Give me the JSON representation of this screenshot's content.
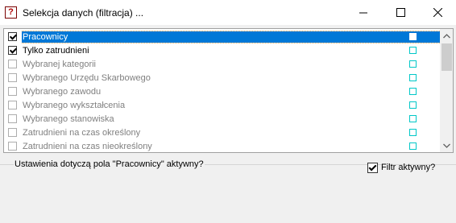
{
  "window": {
    "title": "Selekcja danych (filtracja) ...",
    "app_icon": "app-icon",
    "app_icon_glyph": "?"
  },
  "list": {
    "items": [
      {
        "label": "Pracownicy",
        "checked": true,
        "enabled": true,
        "selected": true
      },
      {
        "label": "Tylko zatrudnieni",
        "checked": true,
        "enabled": true,
        "selected": false
      },
      {
        "label": "Wybranej kategorii",
        "checked": false,
        "enabled": false,
        "selected": false
      },
      {
        "label": "Wybranego Urzędu Skarbowego",
        "checked": false,
        "enabled": false,
        "selected": false
      },
      {
        "label": "Wybranego zawodu",
        "checked": false,
        "enabled": false,
        "selected": false
      },
      {
        "label": "Wybranego wykształcenia",
        "checked": false,
        "enabled": false,
        "selected": false
      },
      {
        "label": "Wybranego stanowiska",
        "checked": false,
        "enabled": false,
        "selected": false
      },
      {
        "label": "Zatrudnieni na czas określony",
        "checked": false,
        "enabled": false,
        "selected": false
      },
      {
        "label": "Zatrudnieni na czas nieokreślony",
        "checked": false,
        "enabled": false,
        "selected": false
      }
    ],
    "marker_color": "#00c8c8",
    "selection_color": "#0078d7"
  },
  "settings": {
    "group_label": "Ustawienia dotyczą pola \"Pracownicy\" aktywny?",
    "filter_label": "Filtr aktywny?",
    "filter_checked": true
  }
}
